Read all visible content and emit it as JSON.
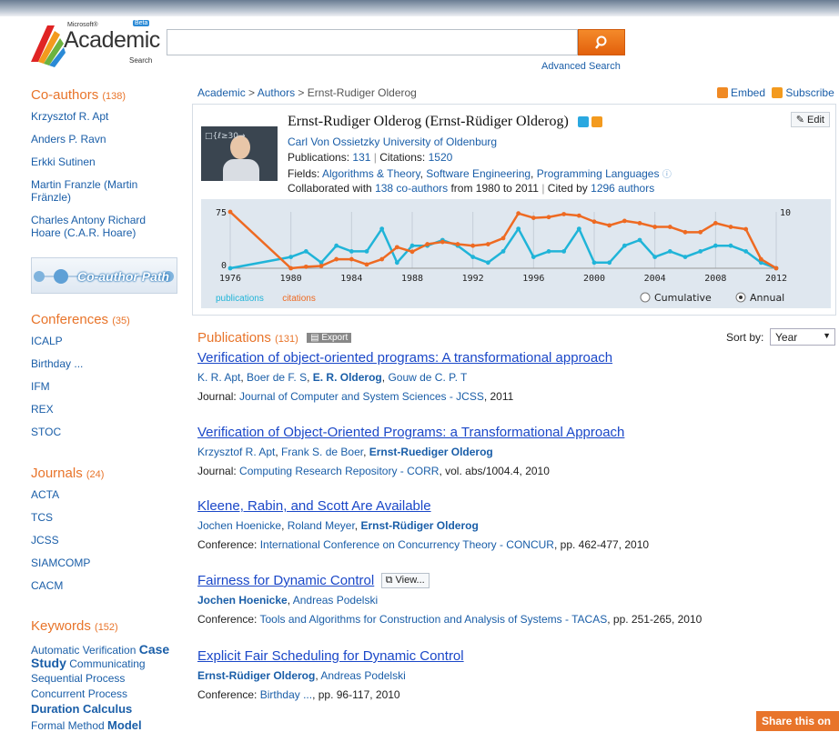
{
  "header": {
    "logo_ms": "Microsoft®",
    "logo_beta": "Beta",
    "logo_word": "Academic",
    "logo_sub": "Search",
    "search_value": "",
    "advanced": "Advanced Search"
  },
  "sidebar": {
    "coauthors": {
      "title": "Co-authors",
      "count": "(138)",
      "items": [
        "Krzysztof R. Apt",
        "Anders P. Ravn",
        "Erkki Sutinen",
        "Martin Franzle (Martin Fränzle)",
        "Charles Antony Richard Hoare (C.A.R. Hoare)"
      ]
    },
    "path_label": "Co-author Path",
    "conferences": {
      "title": "Conferences",
      "count": "(35)",
      "items": [
        "ICALP",
        "Birthday ...",
        "IFM",
        "REX",
        "STOC"
      ]
    },
    "journals": {
      "title": "Journals",
      "count": "(24)",
      "items": [
        "ACTA",
        "TCS",
        "JCSS",
        "SIAMCOMP",
        "CACM"
      ]
    },
    "keywords": {
      "title": "Keywords",
      "count": "(152)",
      "line1": "Automatic Verification",
      "case": "Case",
      "study": "Study",
      "comm": "Communicating",
      "seq": "Sequential Process",
      "conc": "Concurrent Process",
      "dur": "Duration Calculus",
      "fm": "Formal Method",
      "model": "Model"
    }
  },
  "breadcrumb": {
    "academic": "Academic",
    "sep": ">",
    "authors": "Authors",
    "current": "Ernst-Rudiger Olderog"
  },
  "actions": {
    "embed": "Embed",
    "subscribe": "Subscribe",
    "edit": "Edit"
  },
  "profile": {
    "name": "Ernst-Rudiger Olderog (Ernst-Rüdiger Olderog)",
    "affiliation": "Carl Von Ossietzky University of Oldenburg",
    "pubs_label": "Publications:",
    "pubs": "131",
    "cites_label": "Citations:",
    "cites": "1520",
    "fields_label": "Fields:",
    "fields": [
      "Algorithms & Theory",
      "Software Engineering",
      "Programming Languages"
    ],
    "collab_pre": "Collaborated with",
    "collab_link": "138 co-authors",
    "collab_mid": "from 1980 to 2011",
    "cited_pre": "Cited by",
    "cited_link": "1296 authors",
    "photo_text": "□{ℓ≥30→"
  },
  "chart_data": {
    "type": "line",
    "x": [
      1976,
      1977,
      1978,
      1979,
      1980,
      1981,
      1982,
      1983,
      1984,
      1985,
      1986,
      1987,
      1988,
      1989,
      1990,
      1991,
      1992,
      1993,
      1994,
      1995,
      1996,
      1997,
      1998,
      1999,
      2000,
      2001,
      2002,
      2003,
      2004,
      2005,
      2006,
      2007,
      2008,
      2009,
      2010,
      2011,
      2012
    ],
    "series": [
      {
        "name": "publications",
        "color": "#20b4d8",
        "axis": "right",
        "values": [
          0,
          null,
          null,
          null,
          2,
          3,
          1,
          4,
          3,
          3,
          7,
          1,
          4,
          4,
          5,
          4,
          2,
          1,
          3,
          7,
          2,
          3,
          3,
          7,
          1,
          1,
          4,
          5,
          2,
          3,
          2,
          3,
          4,
          4,
          3,
          1,
          0
        ]
      },
      {
        "name": "citations",
        "color": "#ee6a22",
        "axis": "left",
        "values": [
          75,
          null,
          null,
          null,
          0,
          2,
          3,
          12,
          12,
          5,
          12,
          28,
          22,
          32,
          35,
          32,
          30,
          32,
          40,
          73,
          67,
          68,
          72,
          70,
          62,
          57,
          63,
          60,
          55,
          55,
          48,
          48,
          60,
          55,
          52,
          12,
          0
        ]
      }
    ],
    "xticks": [
      "1976",
      "1980",
      "1984",
      "1988",
      "1992",
      "1996",
      "2000",
      "2004",
      "2008",
      "2012"
    ],
    "yleft": {
      "ticks": [
        "75",
        "0"
      ],
      "range": [
        0,
        75
      ]
    },
    "yright": {
      "ticks": [
        "10"
      ],
      "range": [
        0,
        10
      ]
    },
    "legend": [
      "publications",
      "citations"
    ],
    "modes": {
      "cumulative": "Cumulative",
      "annual": "Annual",
      "selected": "annual"
    }
  },
  "publications": {
    "title": "Publications",
    "count": "(131)",
    "export": "Export",
    "sort_label": "Sort by:",
    "sort_value": "Year",
    "items": [
      {
        "title": "Verification of object-oriented programs: A transformational approach",
        "authors": [
          "K. R. Apt",
          "Boer de F. S",
          "E. R. Olderog",
          "Gouw de C. P. T"
        ],
        "venue_type": "Journal:",
        "venue": "Journal of Computer and System Sciences - JCSS",
        "extra": ", 2011"
      },
      {
        "title": "Verification of Object-Oriented Programs: a Transformational Approach",
        "authors": [
          "Krzysztof R. Apt",
          "Frank S. de Boer",
          "Ernst-Ruediger Olderog"
        ],
        "venue_type": "Journal:",
        "venue": "Computing Research Repository - CORR",
        "extra": ", vol. abs/1004.4, 2010"
      },
      {
        "title": "Kleene, Rabin, and Scott Are Available",
        "authors": [
          "Jochen Hoenicke",
          "Roland Meyer",
          "Ernst-Rüdiger Olderog"
        ],
        "venue_type": "Conference:",
        "venue": "International Conference on Concurrency Theory - CONCUR",
        "extra": ", pp. 462-477, 2010"
      },
      {
        "title": "Fairness for Dynamic Control",
        "view": "View...",
        "authors": [
          "Jochen Hoenicke",
          "Andreas Podelski"
        ],
        "venue_type": "Conference:",
        "venue": "Tools and Algorithms for Construction and Analysis of Systems - TACAS",
        "extra": ", pp. 251-265, 2010"
      },
      {
        "title": "Explicit Fair Scheduling for Dynamic Control",
        "authors": [
          "Ernst-Rüdiger Olderog",
          "Andreas Podelski"
        ],
        "venue_type": "Conference:",
        "venue": "Birthday ...",
        "extra": ", pp. 96-117, 2010"
      }
    ]
  },
  "share": "Share this on"
}
